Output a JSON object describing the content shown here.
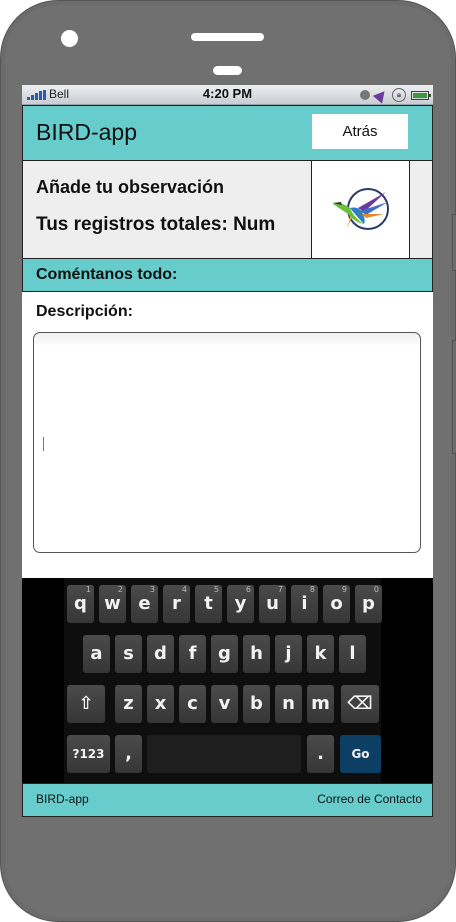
{
  "status": {
    "carrier": "Bell",
    "time": "4:20 PM"
  },
  "header": {
    "title": "BIRD-app",
    "back_label": "Atrás"
  },
  "observation": {
    "title": "Añade tu observación",
    "total": "Tus registros totales: Num"
  },
  "comment": {
    "title": "Coméntanos todo:"
  },
  "form": {
    "description_label": "Descripción:",
    "description_value": ""
  },
  "keyboard": {
    "row1": [
      {
        "k": "q",
        "h": "1"
      },
      {
        "k": "w",
        "h": "2"
      },
      {
        "k": "e",
        "h": "3"
      },
      {
        "k": "r",
        "h": "4"
      },
      {
        "k": "t",
        "h": "5"
      },
      {
        "k": "y",
        "h": "6"
      },
      {
        "k": "u",
        "h": "7"
      },
      {
        "k": "i",
        "h": "8"
      },
      {
        "k": "o",
        "h": "9"
      },
      {
        "k": "p",
        "h": "0"
      }
    ],
    "row2": [
      "a",
      "s",
      "d",
      "f",
      "g",
      "h",
      "j",
      "k",
      "l"
    ],
    "row3": [
      "z",
      "x",
      "c",
      "v",
      "b",
      "n",
      "m"
    ],
    "shift": "⇧",
    "backspace": "⌫",
    "symbols": "?123",
    "comma": ",",
    "period": ".",
    "go": "Go"
  },
  "footer": {
    "left": "BIRD-app",
    "right": "Correo de Contacto"
  },
  "colors": {
    "accent": "#66cccc",
    "panel": "#eeeeee",
    "go_key": "#0d3e63"
  }
}
